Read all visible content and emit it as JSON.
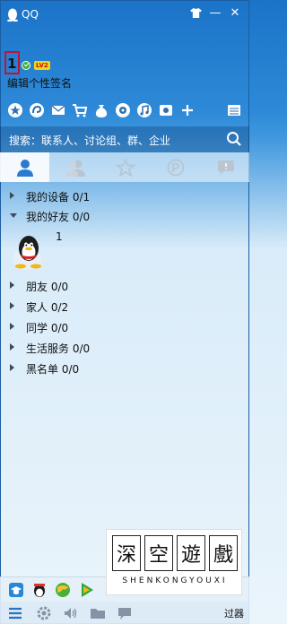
{
  "window": {
    "title": "QQ"
  },
  "profile": {
    "nickname": "1",
    "level": "LV2",
    "signature": "编辑个性签名"
  },
  "search": {
    "placeholder": "搜索：联系人、讨论组、群、企业"
  },
  "groups_top": [
    {
      "label": "我的设备 0/1",
      "expanded": false
    },
    {
      "label": "我的好友 0/0",
      "expanded": true
    }
  ],
  "contact": {
    "name": "1"
  },
  "groups_bottom": [
    {
      "label": "朋友 0/0"
    },
    {
      "label": "家人 0/2"
    },
    {
      "label": "同学 0/0"
    },
    {
      "label": "生活服务 0/0"
    },
    {
      "label": "黑名单 0/0"
    }
  ],
  "watermark": {
    "chars": [
      "深",
      "空",
      "遊",
      "戲"
    ],
    "pinyin": "SHENKONGYOUXI"
  },
  "bottom_partial_text": "过器",
  "colors": {
    "titlebar": "#1b73c8",
    "accent": "#2e8ad8",
    "online": "#3fb03a",
    "highlight_box": "#c0133c"
  }
}
